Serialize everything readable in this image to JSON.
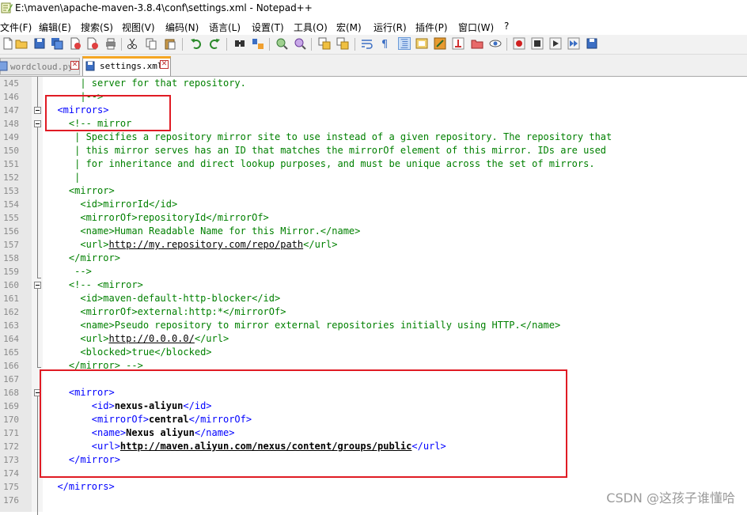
{
  "window": {
    "title": "E:\\maven\\apache-maven-3.8.4\\conf\\settings.xml - Notepad++"
  },
  "menu": [
    "文件(F)",
    "编辑(E)",
    "搜索(S)",
    "视图(V)",
    "编码(N)",
    "语言(L)",
    "设置(T)",
    "工具(O)",
    "宏(M)",
    "运行(R)",
    "插件(P)",
    "窗口(W)",
    "?"
  ],
  "toolbar": {
    "icons": [
      "new-file-icon",
      "open-file-icon",
      "save-icon",
      "save-all-icon",
      "close-icon",
      "close-all-icon",
      "print-icon",
      "cut-icon",
      "copy-icon",
      "paste-icon",
      "undo-icon",
      "redo-icon",
      "find-icon",
      "replace-icon",
      "zoom-in-icon",
      "zoom-out-icon",
      "sync-vertical-icon",
      "sync-horizontal-icon",
      "word-wrap-icon",
      "show-all-chars-icon",
      "indent-guide-icon",
      "doc-map-icon",
      "function-list-icon",
      "folder-workspace-icon",
      "monitoring-icon",
      "record-macro-icon",
      "stop-record-icon",
      "play-macro-icon",
      "run-multiple-macro-icon",
      "save-macro-icon"
    ]
  },
  "tabs": [
    {
      "label": "wordcloud.py",
      "active": false
    },
    {
      "label": "settings.xml",
      "active": true
    }
  ],
  "editor": {
    "lines": [
      {
        "n": "145",
        "ind": "      ",
        "segs": [
          [
            "cm",
            "| server for that repository."
          ]
        ]
      },
      {
        "n": "146",
        "ind": "      ",
        "segs": [
          [
            "cm",
            "|-->"
          ]
        ]
      },
      {
        "n": "147",
        "ind": "  ",
        "segs": [
          [
            "tag",
            "<mirrors>"
          ]
        ]
      },
      {
        "n": "148",
        "ind": "    ",
        "segs": [
          [
            "cm",
            "<!-- mirror"
          ]
        ]
      },
      {
        "n": "149",
        "ind": "     ",
        "segs": [
          [
            "cm",
            "| Specifies a repository mirror site to use instead of a given repository. The repository that"
          ]
        ]
      },
      {
        "n": "150",
        "ind": "     ",
        "segs": [
          [
            "cm",
            "| this mirror serves has an ID that matches the mirrorOf element of this mirror. IDs are used"
          ]
        ]
      },
      {
        "n": "151",
        "ind": "     ",
        "segs": [
          [
            "cm",
            "| for inheritance and direct lookup purposes, and must be unique across the set of mirrors."
          ]
        ]
      },
      {
        "n": "152",
        "ind": "     ",
        "segs": [
          [
            "cm",
            "|"
          ]
        ]
      },
      {
        "n": "153",
        "ind": "    ",
        "segs": [
          [
            "cm",
            "<mirror>"
          ]
        ]
      },
      {
        "n": "154",
        "ind": "      ",
        "segs": [
          [
            "cm",
            "<id>mirrorId</id>"
          ]
        ]
      },
      {
        "n": "155",
        "ind": "      ",
        "segs": [
          [
            "cm",
            "<mirrorOf>repositoryId</mirrorOf>"
          ]
        ]
      },
      {
        "n": "156",
        "ind": "      ",
        "segs": [
          [
            "cm",
            "<name>Human Readable Name for this Mirror.</name>"
          ]
        ]
      },
      {
        "n": "157",
        "ind": "      ",
        "segs": [
          [
            "cm",
            "<url>"
          ],
          [
            "cmu",
            "http://my.repository.com/repo/path"
          ],
          [
            "cm",
            "</url>"
          ]
        ]
      },
      {
        "n": "158",
        "ind": "    ",
        "segs": [
          [
            "cm",
            "</mirror>"
          ]
        ]
      },
      {
        "n": "159",
        "ind": "     ",
        "segs": [
          [
            "cm",
            "-->"
          ]
        ]
      },
      {
        "n": "160",
        "ind": "    ",
        "segs": [
          [
            "cm",
            "<!-- <mirror>"
          ]
        ]
      },
      {
        "n": "161",
        "ind": "      ",
        "segs": [
          [
            "cm",
            "<id>maven-default-http-blocker</id>"
          ]
        ]
      },
      {
        "n": "162",
        "ind": "      ",
        "segs": [
          [
            "cm",
            "<mirrorOf>external:http:*</mirrorOf>"
          ]
        ]
      },
      {
        "n": "163",
        "ind": "      ",
        "segs": [
          [
            "cm",
            "<name>Pseudo repository to mirror external repositories initially using HTTP.</name>"
          ]
        ]
      },
      {
        "n": "164",
        "ind": "      ",
        "segs": [
          [
            "cm",
            "<url>"
          ],
          [
            "cmu",
            "http://0.0.0.0/"
          ],
          [
            "cm",
            "</url>"
          ]
        ]
      },
      {
        "n": "165",
        "ind": "      ",
        "segs": [
          [
            "cm",
            "<blocked>true</blocked>"
          ]
        ]
      },
      {
        "n": "166",
        "ind": "    ",
        "segs": [
          [
            "cm",
            "</mirror> -->"
          ]
        ]
      },
      {
        "n": "167",
        "ind": "",
        "segs": []
      },
      {
        "n": "168",
        "ind": "    ",
        "segs": [
          [
            "tag",
            "<mirror>"
          ]
        ]
      },
      {
        "n": "169",
        "ind": "        ",
        "segs": [
          [
            "tag",
            "<id>"
          ],
          [
            "bold",
            "nexus-aliyun"
          ],
          [
            "tag",
            "</id>"
          ]
        ]
      },
      {
        "n": "170",
        "ind": "        ",
        "segs": [
          [
            "tag",
            "<mirrorOf>"
          ],
          [
            "bold",
            "central"
          ],
          [
            "tag",
            "</mirrorOf>"
          ]
        ]
      },
      {
        "n": "171",
        "ind": "        ",
        "segs": [
          [
            "tag",
            "<name>"
          ],
          [
            "bold",
            "Nexus aliyun"
          ],
          [
            "tag",
            "</name>"
          ]
        ]
      },
      {
        "n": "172",
        "ind": "        ",
        "segs": [
          [
            "tag",
            "<url>"
          ],
          [
            "urlb",
            "http://maven.aliyun.com/nexus/content/groups/public"
          ],
          [
            "tag",
            "</url>"
          ]
        ]
      },
      {
        "n": "173",
        "ind": "    ",
        "segs": [
          [
            "tag",
            "</mirror>"
          ]
        ]
      },
      {
        "n": "174",
        "ind": "",
        "segs": []
      },
      {
        "n": "175",
        "ind": "  ",
        "segs": [
          [
            "tag",
            "</mirrors>"
          ]
        ]
      },
      {
        "n": "176",
        "ind": "",
        "segs": []
      }
    ]
  },
  "watermark": "CSDN @这孩子谁懂哈"
}
